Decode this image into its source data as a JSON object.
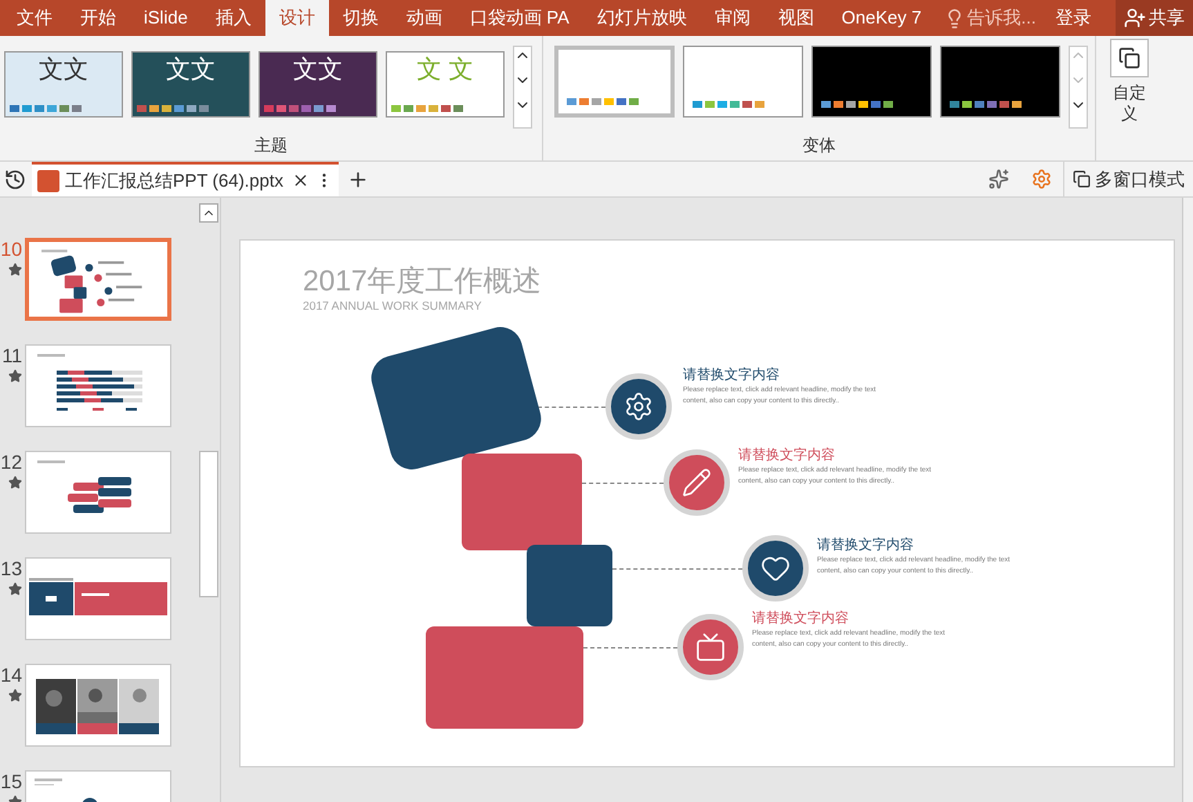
{
  "ribbon_tabs": [
    {
      "label": "文件",
      "selected": false
    },
    {
      "label": "开始",
      "selected": false
    },
    {
      "label": "iSlide",
      "selected": false
    },
    {
      "label": "插入",
      "selected": false
    },
    {
      "label": "设计",
      "selected": true
    },
    {
      "label": "切换",
      "selected": false
    },
    {
      "label": "动画",
      "selected": false
    },
    {
      "label": "口袋动画 PA",
      "selected": false
    },
    {
      "label": "幻灯片放映",
      "selected": false
    },
    {
      "label": "审阅",
      "selected": false
    },
    {
      "label": "视图",
      "selected": false
    },
    {
      "label": "OneKey 7",
      "selected": false
    }
  ],
  "tell_me": "告诉我...",
  "sign_in": "登录",
  "share": "共享",
  "themes": {
    "label": "主题",
    "items": [
      {
        "kind": "pattern",
        "text": "文文"
      },
      {
        "kind": "teal",
        "text": "文文"
      },
      {
        "kind": "purple",
        "text": "文文"
      },
      {
        "kind": "green",
        "text": "文 文"
      }
    ]
  },
  "variants": {
    "label": "变体",
    "items": [
      {
        "selected": true
      },
      {
        "selected": false
      },
      {
        "selected": false
      },
      {
        "selected": false
      }
    ]
  },
  "customize": "自定义",
  "file_name": "工作汇报总结PPT (64).pptx",
  "multi_window": "多窗口模式",
  "slides": [
    {
      "number": "10",
      "selected": true,
      "kind": "timeline"
    },
    {
      "number": "11",
      "selected": false,
      "kind": "bars"
    },
    {
      "number": "12",
      "selected": false,
      "kind": "arrows"
    },
    {
      "number": "13",
      "selected": false,
      "kind": "section"
    },
    {
      "number": "14",
      "selected": false,
      "kind": "photos"
    },
    {
      "number": "15",
      "selected": false,
      "kind": "timeline"
    }
  ],
  "slide": {
    "title": "2017年度工作概述",
    "subtitle": "2017 ANNUAL WORK SUMMARY",
    "items": [
      {
        "color": "#1f4a6b",
        "heading": "请替换文字内容",
        "body": "Please replace text, click add relevant headline, modify the text content, also can copy your content to this directly.."
      },
      {
        "color": "#cf4d5b",
        "heading": "请替换文字内容",
        "body": "Please replace text, click add relevant headline, modify the text content, also can copy your content to this directly.."
      },
      {
        "color": "#1f4a6b",
        "heading": "请替换文字内容",
        "body": "Please replace text, click add relevant headline, modify the text content, also can copy your content to this directly.."
      },
      {
        "color": "#cf4d5b",
        "heading": "请替换文字内容",
        "body": "Please replace text, click add relevant headline, modify the text content, also can copy your content to this directly.."
      }
    ]
  }
}
